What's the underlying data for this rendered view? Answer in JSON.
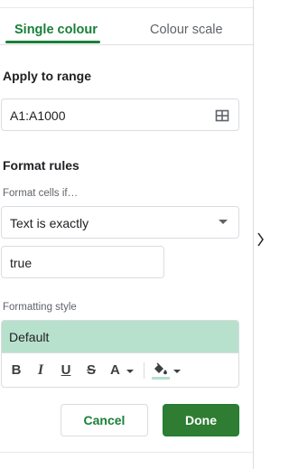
{
  "tabs": [
    {
      "label": "Single colour",
      "active": true
    },
    {
      "label": "Colour scale",
      "active": false
    }
  ],
  "apply_range": {
    "title": "Apply to range",
    "value": "A1:A1000",
    "select_range_icon": "grid-icon"
  },
  "format_rules": {
    "title": "Format rules",
    "condition_label": "Format cells if…",
    "condition_value": "Text is exactly",
    "value_input": "true"
  },
  "formatting_style": {
    "label": "Formatting style",
    "preset_value": "Default",
    "preview_background": "#b7e1cd",
    "toolbar": {
      "bold": "B",
      "italic": "I",
      "underline": "U",
      "strikethrough": "S",
      "text_color": "A",
      "fill_color_icon": "paint-bucket-icon"
    }
  },
  "actions": {
    "cancel_label": "Cancel",
    "done_label": "Done"
  },
  "colors": {
    "accent": "#188038",
    "primary_button": "#2e7d32",
    "style_fill": "#b7e1cd"
  }
}
